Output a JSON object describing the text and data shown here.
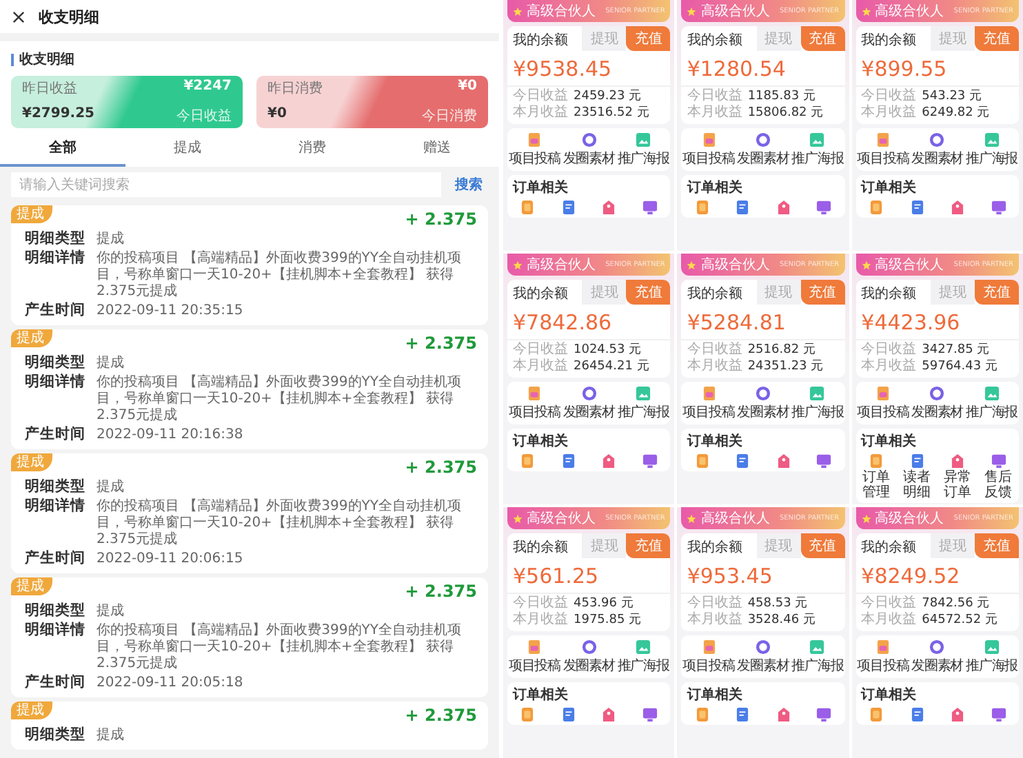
{
  "header": {
    "title": "收支明细"
  },
  "section_title": "收支明细",
  "summary_cards": [
    {
      "kind": "income",
      "top_left": "昨日收益",
      "top_right": "¥2247",
      "bottom_left": "¥2799.25",
      "bottom_right": "今日收益"
    },
    {
      "kind": "expense",
      "top_left": "昨日消费",
      "top_right": "¥0",
      "bottom_left": "¥0",
      "bottom_right": "今日消费"
    }
  ],
  "tabs": [
    {
      "label": "全部",
      "selected": true
    },
    {
      "label": "提成",
      "selected": false
    },
    {
      "label": "消费",
      "selected": false
    },
    {
      "label": "赠送",
      "selected": false
    }
  ],
  "search": {
    "placeholder": "请输入关键词搜索",
    "button": "搜索"
  },
  "records": [
    {
      "tag": "提成",
      "amount": "+ 2.375",
      "fields": [
        {
          "label": "明细类型",
          "value": "提成"
        },
        {
          "label": "明细详情",
          "value": "你的投稿项目 【高端精品】外面收费399的YY全自动挂机项目，号称单窗口一天10-20+【挂机脚本+全套教程】 获得2.375元提成"
        },
        {
          "label": "产生时间",
          "value": "2022-09-11 20:35:15"
        }
      ]
    },
    {
      "tag": "提成",
      "amount": "+ 2.375",
      "fields": [
        {
          "label": "明细类型",
          "value": "提成"
        },
        {
          "label": "明细详情",
          "value": "你的投稿项目 【高端精品】外面收费399的YY全自动挂机项目，号称单窗口一天10-20+【挂机脚本+全套教程】 获得2.375元提成"
        },
        {
          "label": "产生时间",
          "value": "2022-09-11 20:16:38"
        }
      ]
    },
    {
      "tag": "提成",
      "amount": "+ 2.375",
      "fields": [
        {
          "label": "明细类型",
          "value": "提成"
        },
        {
          "label": "明细详情",
          "value": "你的投稿项目 【高端精品】外面收费399的YY全自动挂机项目，号称单窗口一天10-20+【挂机脚本+全套教程】 获得2.375元提成"
        },
        {
          "label": "产生时间",
          "value": "2022-09-11 20:06:15"
        }
      ]
    },
    {
      "tag": "提成",
      "amount": "+ 2.375",
      "fields": [
        {
          "label": "明细类型",
          "value": "提成"
        },
        {
          "label": "明细详情",
          "value": "你的投稿项目 【高端精品】外面收费399的YY全自动挂机项目，号称单窗口一天10-20+【挂机脚本+全套教程】 获得2.375元提成"
        },
        {
          "label": "产生时间",
          "value": "2022-09-11 20:05:18"
        }
      ]
    },
    {
      "tag": "提成",
      "amount": "+ 2.375",
      "fields": [
        {
          "label": "明细类型",
          "value": "提成"
        }
      ]
    }
  ],
  "panels": [
    {
      "badge": "高级合伙人",
      "badge_en": "SENIOR PARTNER",
      "balance_label": "我的余额",
      "buttons": [
        {
          "label": "提现",
          "selected": false
        },
        {
          "label": "充值",
          "selected": true
        }
      ],
      "balance": "¥9538.45",
      "stats": [
        {
          "label": "今日收益",
          "value": "2459.23 元"
        },
        {
          "label": "本月收益",
          "value": "23516.52 元"
        }
      ],
      "features": [
        "项目投稿",
        "发圈素材",
        "推广海报"
      ],
      "orders_title": "订单相关"
    },
    {
      "badge": "高级合伙人",
      "badge_en": "SENIOR PARTNER",
      "balance_label": "我的余额",
      "buttons": [
        {
          "label": "提现",
          "selected": false
        },
        {
          "label": "充值",
          "selected": true
        }
      ],
      "balance": "¥1280.54",
      "stats": [
        {
          "label": "今日收益",
          "value": "1185.83 元"
        },
        {
          "label": "本月收益",
          "value": "15806.82 元"
        }
      ],
      "features": [
        "项目投稿",
        "发圈素材",
        "推广海报"
      ],
      "orders_title": "订单相关"
    },
    {
      "badge": "高级合伙人",
      "badge_en": "SENIOR PARTNER",
      "balance_label": "我的余额",
      "buttons": [
        {
          "label": "提现",
          "selected": false
        },
        {
          "label": "充值",
          "selected": true
        }
      ],
      "balance": "¥899.55",
      "stats": [
        {
          "label": "今日收益",
          "value": "543.23 元"
        },
        {
          "label": "本月收益",
          "value": "6249.82 元"
        }
      ],
      "features": [
        "项目投稿",
        "发圈素材",
        "推广海报"
      ],
      "orders_title": "订单相关"
    },
    {
      "badge": "高级合伙人",
      "badge_en": "SENIOR PARTNER",
      "balance_label": "我的余额",
      "buttons": [
        {
          "label": "提现",
          "selected": false
        },
        {
          "label": "充值",
          "selected": true
        }
      ],
      "balance": "¥7842.86",
      "stats": [
        {
          "label": "今日收益",
          "value": "1024.53 元"
        },
        {
          "label": "本月收益",
          "value": "26454.21 元"
        }
      ],
      "features": [
        "项目投稿",
        "发圈素材",
        "推广海报"
      ],
      "orders_title": "订单相关"
    },
    {
      "badge": "高级合伙人",
      "badge_en": "SENIOR PARTNER",
      "balance_label": "我的余额",
      "buttons": [
        {
          "label": "提现",
          "selected": false
        },
        {
          "label": "充值",
          "selected": true
        }
      ],
      "balance": "¥5284.81",
      "stats": [
        {
          "label": "今日收益",
          "value": "2516.82 元"
        },
        {
          "label": "本月收益",
          "value": "24351.23 元"
        }
      ],
      "features": [
        "项目投稿",
        "发圈素材",
        "推广海报"
      ],
      "orders_title": "订单相关"
    },
    {
      "badge": "高级合伙人",
      "badge_en": "SENIOR PARTNER",
      "balance_label": "我的余额",
      "buttons": [
        {
          "label": "提现",
          "selected": false
        },
        {
          "label": "充值",
          "selected": true
        }
      ],
      "balance": "¥4423.96",
      "stats": [
        {
          "label": "今日收益",
          "value": "3427.85 元"
        },
        {
          "label": "本月收益",
          "value": "59764.43 元"
        }
      ],
      "features": [
        "项目投稿",
        "发圈素材",
        "推广海报"
      ],
      "orders_title": "订单相关",
      "order_labels": [
        "订单管理",
        "读者明细",
        "异常订单",
        "售后反馈"
      ]
    },
    {
      "badge": "高级合伙人",
      "badge_en": "SENIOR PARTNER",
      "balance_label": "我的余额",
      "buttons": [
        {
          "label": "提现",
          "selected": false
        },
        {
          "label": "充值",
          "selected": true
        }
      ],
      "balance": "¥561.25",
      "stats": [
        {
          "label": "今日收益",
          "value": "453.96 元"
        },
        {
          "label": "本月收益",
          "value": "1975.85 元"
        }
      ],
      "features": [
        "项目投稿",
        "发圈素材",
        "推广海报"
      ],
      "orders_title": "订单相关"
    },
    {
      "badge": "高级合伙人",
      "badge_en": "SENIOR PARTNER",
      "balance_label": "我的余额",
      "buttons": [
        {
          "label": "提现",
          "selected": false
        },
        {
          "label": "充值",
          "selected": true
        }
      ],
      "balance": "¥953.45",
      "stats": [
        {
          "label": "今日收益",
          "value": "458.53 元"
        },
        {
          "label": "本月收益",
          "value": "3528.46 元"
        }
      ],
      "features": [
        "项目投稿",
        "发圈素材",
        "推广海报"
      ],
      "orders_title": "订单相关"
    },
    {
      "badge": "高级合伙人",
      "badge_en": "SENIOR PARTNER",
      "balance_label": "我的余额",
      "buttons": [
        {
          "label": "提现",
          "selected": false
        },
        {
          "label": "充值",
          "selected": true
        }
      ],
      "balance": "¥8249.52",
      "stats": [
        {
          "label": "今日收益",
          "value": "7842.56 元"
        },
        {
          "label": "本月收益",
          "value": "64572.52 元"
        }
      ],
      "features": [
        "项目投稿",
        "发圈素材",
        "推广海报"
      ],
      "orders_title": "订单相关"
    }
  ]
}
